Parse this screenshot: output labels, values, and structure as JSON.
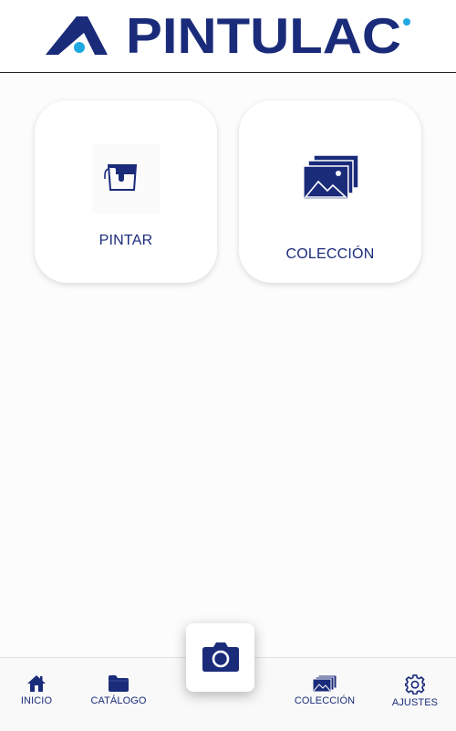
{
  "header": {
    "brand": "PINTULAC",
    "logo_icon": "pintulac-logo",
    "brand_color": "#1a2b7a",
    "accent_color": "#1ea9e1"
  },
  "cards": [
    {
      "label": "PINTAR",
      "icon": "paint-bucket-icon"
    },
    {
      "label": "COLECCIÓN",
      "icon": "gallery-icon"
    }
  ],
  "bottom_nav": {
    "items": [
      {
        "label": "INICIO",
        "icon": "home-icon"
      },
      {
        "label": "CATÁLOGO",
        "icon": "folder-icon"
      },
      {
        "label": "COLECCIÓN",
        "icon": "gallery-icon"
      },
      {
        "label": "AJUSTES",
        "icon": "gear-icon"
      }
    ],
    "camera_icon": "camera-icon"
  }
}
